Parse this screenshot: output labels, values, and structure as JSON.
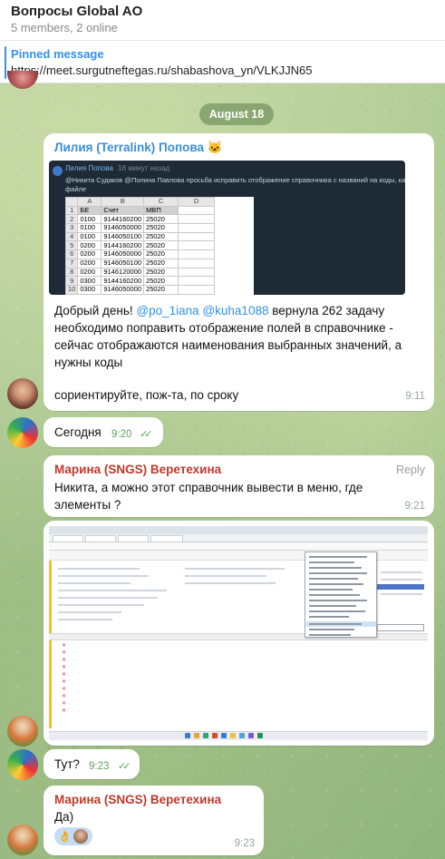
{
  "header": {
    "title": "Вопросы Global AO",
    "subtitle": "5 members, 2 online"
  },
  "pinned": {
    "label": "Pinned message",
    "text": "https://meet.surgutneftegas.ru/shabashova_yn/VLKJJN65"
  },
  "date_separator": "August 18",
  "messages": [
    {
      "sender": "Лилия (Terralink) Попова 🐱",
      "forward": {
        "name": "Лилия Попова",
        "time_ago": "16 минут назад",
        "line1": "@Никита Судаков @Полина Павлова просьба исправить отображение справочника с названий на коды, как в приложенном",
        "line2": "файле",
        "sheet": {
          "columns": [
            "A",
            "B",
            "C",
            "D"
          ],
          "header_row": [
            "БЕ",
            "Счет",
            "МВП",
            ""
          ],
          "rows": [
            [
              "0100",
              "9144160200",
              "25020",
              ""
            ],
            [
              "0100",
              "9146050000",
              "25020",
              ""
            ],
            [
              "0100",
              "9146050100",
              "25020",
              ""
            ],
            [
              "0200",
              "9144160200",
              "25020",
              ""
            ],
            [
              "0200",
              "9146050000",
              "25020",
              ""
            ],
            [
              "0200",
              "9146050100",
              "25020",
              ""
            ],
            [
              "0200",
              "9146120000",
              "25020",
              ""
            ],
            [
              "0300",
              "9144160200",
              "25020",
              ""
            ],
            [
              "0300",
              "9146050000",
              "25020",
              ""
            ]
          ],
          "row_numbers": [
            "1",
            "2",
            "3",
            "4",
            "5",
            "6",
            "7",
            "8",
            "9",
            "10",
            "11"
          ]
        }
      },
      "text_intro": "Добрый день! ",
      "mention1": "@po_1iana",
      "mention2": "@kuha1088",
      "text_rest": " вернула 262 задачу необходимо поправить отображение полей в справочнике - сейчас отображаются наименования выбранных значений, а нужны коды",
      "text2": "сориентируйте, пож-та, по сроку",
      "time": "9:11"
    },
    {
      "text": "Сегодня",
      "time": "9:20",
      "status": "✓✓"
    },
    {
      "sender": "Марина (SNGS) Веретехина",
      "reply_label": "Reply",
      "text": "Никита, а можно этот справочник вывести в меню, где элементы ?",
      "time": "9:21"
    },
    {
      "text": "Тут?",
      "time": "9:23",
      "status": "✓✓"
    },
    {
      "sender": "Марина (SNGS) Веретехина",
      "text": "Да)",
      "reaction": "👌",
      "time": "9:23"
    }
  ]
}
